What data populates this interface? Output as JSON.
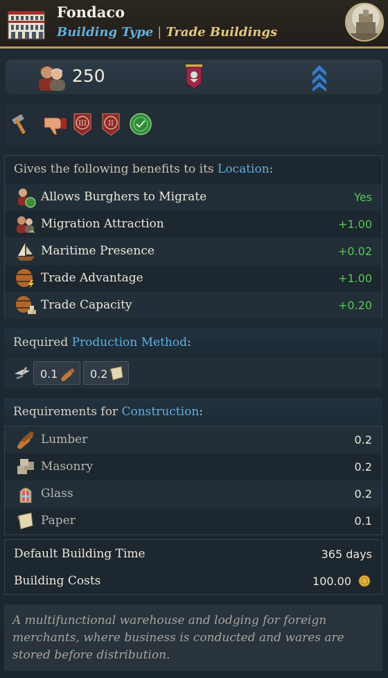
{
  "header": {
    "title": "Fondaco",
    "type_label": "Building Type",
    "separator": "|",
    "category": "Trade Buildings"
  },
  "stats": {
    "population": "250"
  },
  "benefits": {
    "intro": "Gives the following benefits to its ",
    "intro_link": "Location",
    "intro_end": ":",
    "rows": [
      {
        "label": "Allows Burghers to Migrate",
        "value": "Yes",
        "icon": "burghers-migrate-icon"
      },
      {
        "label": "Migration Attraction",
        "value": "+1.00",
        "icon": "migration-icon"
      },
      {
        "label": "Maritime Presence",
        "value": "+0.02",
        "icon": "ship-icon"
      },
      {
        "label": "Trade Advantage",
        "value": "+1.00",
        "icon": "barrel-lightning-icon"
      },
      {
        "label": "Trade Capacity",
        "value": "+0.20",
        "icon": "barrel-crates-icon"
      }
    ]
  },
  "production": {
    "head": "Required ",
    "head_link": "Production Method",
    "head_end": ":",
    "chips": [
      {
        "value": "0.1",
        "icon": "lumber-icon"
      },
      {
        "value": "0.2",
        "icon": "paper-icon"
      }
    ]
  },
  "construction": {
    "head": "Requirements for ",
    "head_link": "Construction",
    "head_end": ":",
    "rows": [
      {
        "label": "Lumber",
        "value": "0.2",
        "icon": "lumber-icon"
      },
      {
        "label": "Masonry",
        "value": "0.2",
        "icon": "masonry-icon"
      },
      {
        "label": "Glass",
        "value": "0.2",
        "icon": "glass-icon"
      },
      {
        "label": "Paper",
        "value": "0.1",
        "icon": "paper-icon"
      }
    ]
  },
  "info": {
    "time_label": "Default Building Time",
    "time_value": "365 days",
    "cost_label": "Building Costs",
    "cost_value": "100.00"
  },
  "description": "A multifunctional warehouse and lodging for foreign merchants, where business is conducted and wares are stored before distribution.",
  "colors": {
    "accent_blue": "#5fb0e0",
    "accent_gold": "#e3c77d",
    "positive_green": "#57c957",
    "border_gold": "#b89a5a"
  }
}
